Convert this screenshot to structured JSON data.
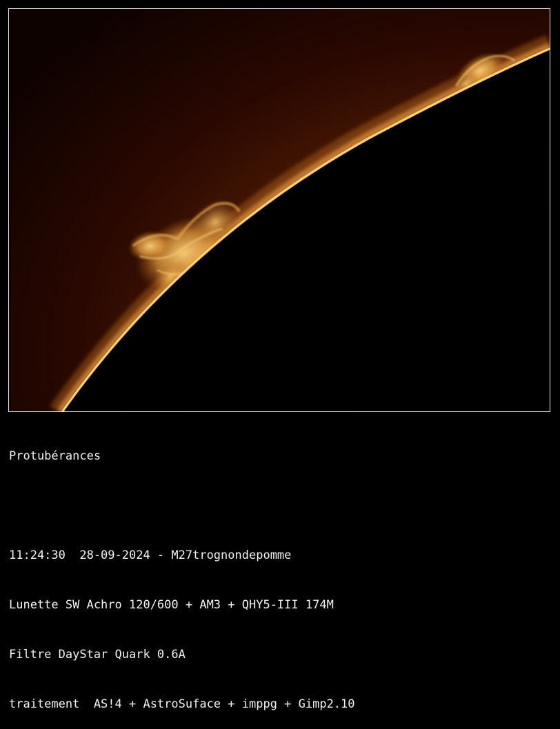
{
  "image": {
    "subject": "solar-limb-prominences",
    "colors": {
      "sky_dark": "#0e0200",
      "sky_mid": "#4a1a03",
      "sky_light": "#7a3a08",
      "limb": "#ffcf6a",
      "prominence": "#e8a648",
      "disk": "#000000",
      "frame_border": "#e8e8e8"
    }
  },
  "caption": {
    "title": "Protubérances",
    "line_datetime": "11:24:30  28-09-2024 - M27trognondepomme",
    "line_equipment": "Lunette SW Achro 120/600 + AM3 + QHY5-III 174M",
    "line_filter": "Filtre DayStar Quark 0.6A",
    "line_processing": "traitement  AS!4 + AstroSuface + imppg + Gimp2.10"
  }
}
